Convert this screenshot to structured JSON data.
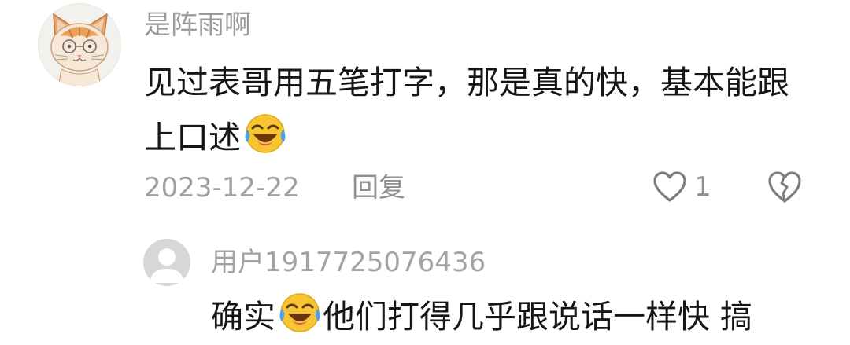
{
  "comment": {
    "username": "是阵雨啊",
    "avatar_icon": "cat-avatar",
    "text_before_emoji": "见过表哥用五笔打字，那是真的快，基本能跟上口述",
    "emoji_icon": "laughing-crying-emoji",
    "date": "2023-12-22",
    "reply_label": "回复",
    "like_count": "1",
    "like_icon": "heart-outline-icon",
    "dislike_icon": "broken-heart-icon"
  },
  "sub_reply": {
    "username": "用户1917725076436",
    "avatar_icon": "default-user-avatar",
    "text_before_emoji": "确实",
    "emoji_icon": "laughing-crying-emoji",
    "text_after_emoji": "他们打得几乎跟说话一样快 搞"
  },
  "colors": {
    "primary_text": "#161616",
    "secondary_text": "#9a9a9a",
    "emoji_yellow": "#f7c531",
    "tear_blue": "#4aa3e8"
  }
}
